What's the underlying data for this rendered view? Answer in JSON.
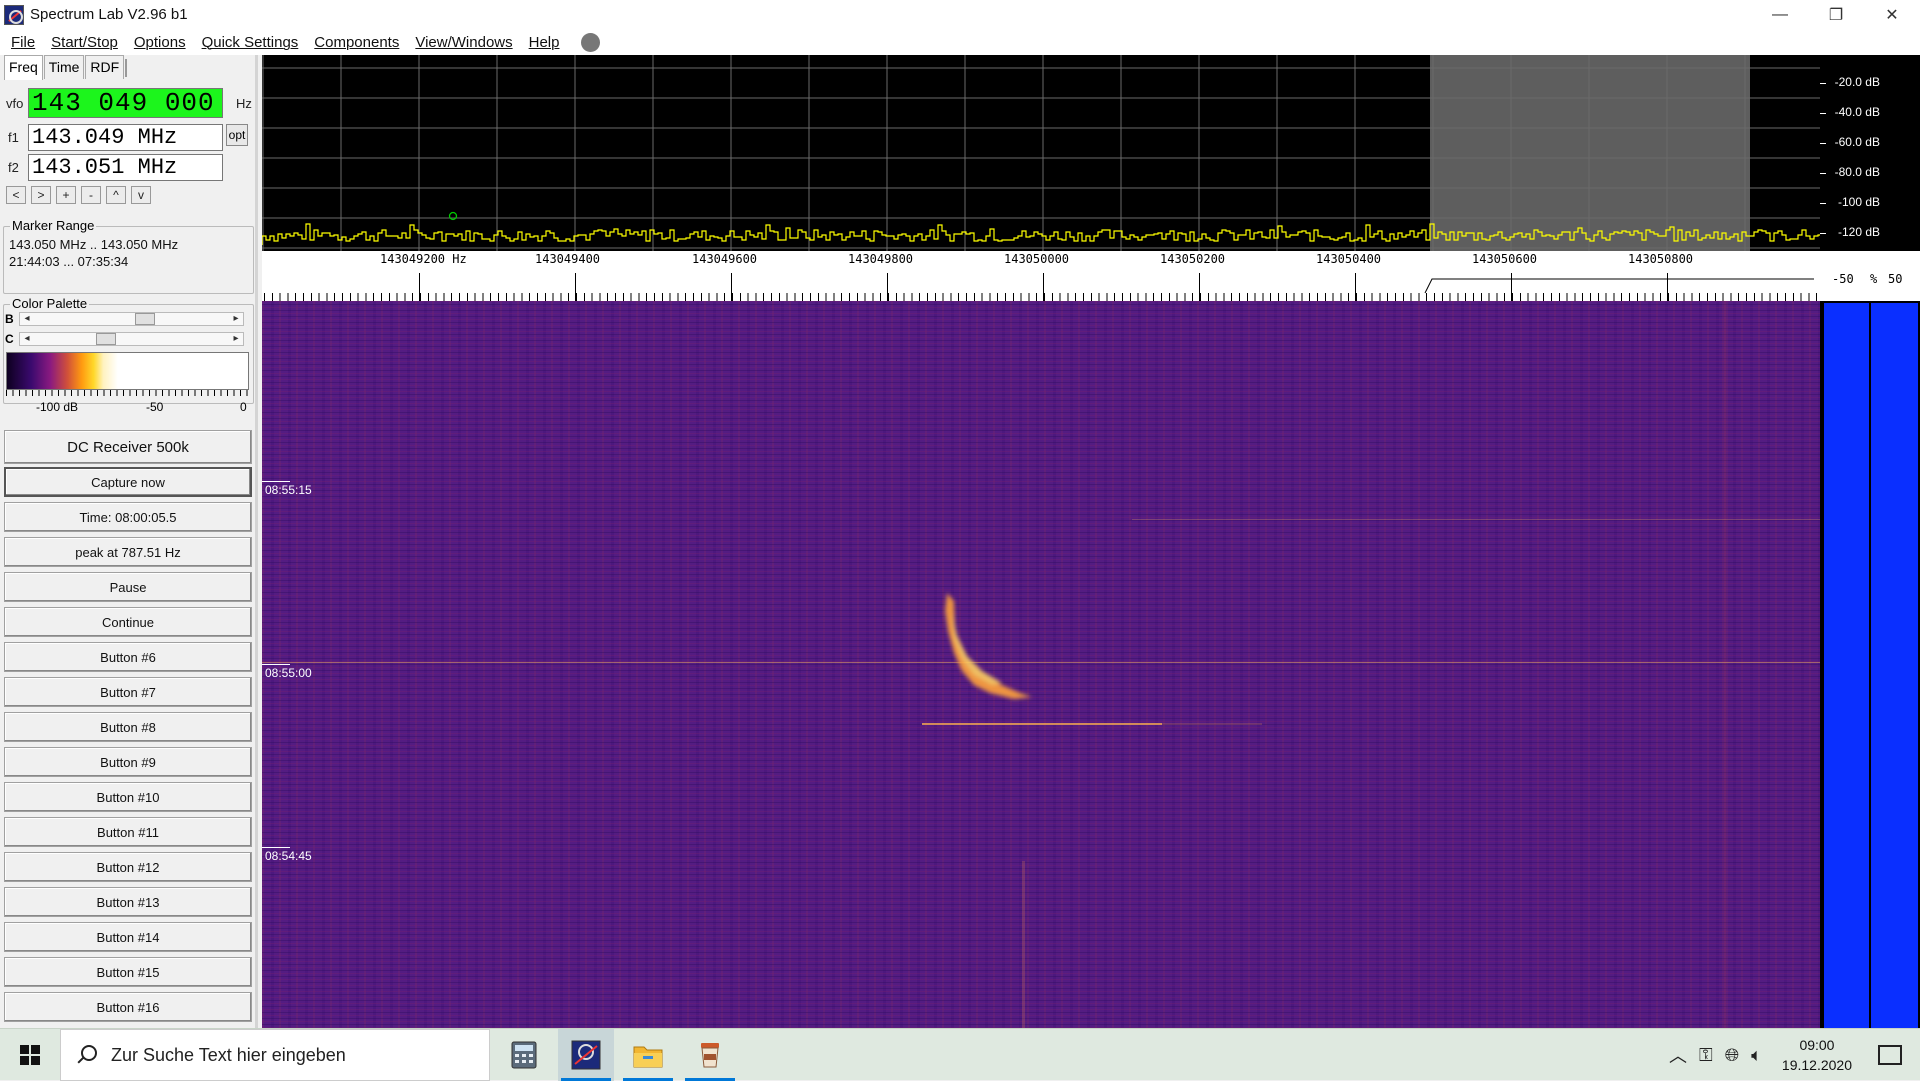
{
  "window": {
    "title": "Spectrum Lab V2.96 b1",
    "minimize": "—",
    "restore": "❐",
    "close": "✕"
  },
  "menu": {
    "items": [
      "File",
      "Start/Stop",
      "Options",
      "Quick Settings",
      "Components",
      "View/Windows",
      "Help"
    ]
  },
  "left": {
    "tabs": [
      "Freq",
      "Time",
      "RDF"
    ],
    "vfo_label": "vfo",
    "vfo_value": "143 049 000",
    "vfo_unit": "Hz",
    "f1_label": "f1",
    "f1_value": "143.049 MHz",
    "f2_label": "f2",
    "f2_value": "143.051 MHz",
    "opt_label": "opt",
    "nav_buttons": [
      "<",
      ">",
      "+",
      "-",
      "^",
      "v"
    ],
    "marker_range": {
      "title": "Marker Range",
      "line1": "143.050 MHz .. 143.050 MHz",
      "line2": "21:44:03 ... 07:35:34"
    },
    "palette": {
      "title": "Color Palette",
      "b_label": "B",
      "c_label": "C",
      "b_level": 0.57,
      "c_level": 0.35,
      "left_arrow": "◂",
      "right_arrow": "▸",
      "scale_labels": [
        "-100 dB",
        "-50",
        "0"
      ]
    },
    "buttons": {
      "receiver": "DC Receiver 500k",
      "capture": "Capture now",
      "time": "Time:  08:00:05.5",
      "peak": "peak at 787.51 Hz",
      "pause": "Pause",
      "continue": "Continue",
      "b6": "Button #6",
      "b7": "Button #7",
      "b8": "Button #8",
      "b9": "Button #9",
      "b10": "Button #10",
      "b11": "Button #11",
      "b12": "Button #12",
      "b13": "Button #13",
      "b14": "Button #14",
      "b15": "Button #15",
      "b16": "Button #16"
    }
  },
  "spectrum": {
    "db_labels": [
      "-20.0 dB",
      "-40.0 dB",
      "-60.0 dB",
      "-80.0 dB",
      "-100 dB",
      "-120 dB"
    ],
    "freq_labels": [
      "143049200  Hz",
      "143049400",
      "143049600",
      "143049800",
      "143050000",
      "143050200",
      "143050400",
      "143050600",
      "143050800"
    ],
    "right_axis": [
      "-50",
      "%",
      "50"
    ],
    "trace_color": "#ffff00",
    "marker_color": "#00cc00"
  },
  "waterfall": {
    "times": [
      "08:55:15",
      "08:55:00",
      "08:54:45"
    ],
    "base_color": "#541c82",
    "meteor_color": "#ffb040"
  },
  "taskbar": {
    "search_placeholder": "Zur Suche Text hier eingeben",
    "time": "09:00",
    "date": "19.12.2020",
    "apps": [
      "calculator-icon",
      "spectrum-lab-icon",
      "file-explorer-icon",
      "coffee-app-icon"
    ]
  }
}
